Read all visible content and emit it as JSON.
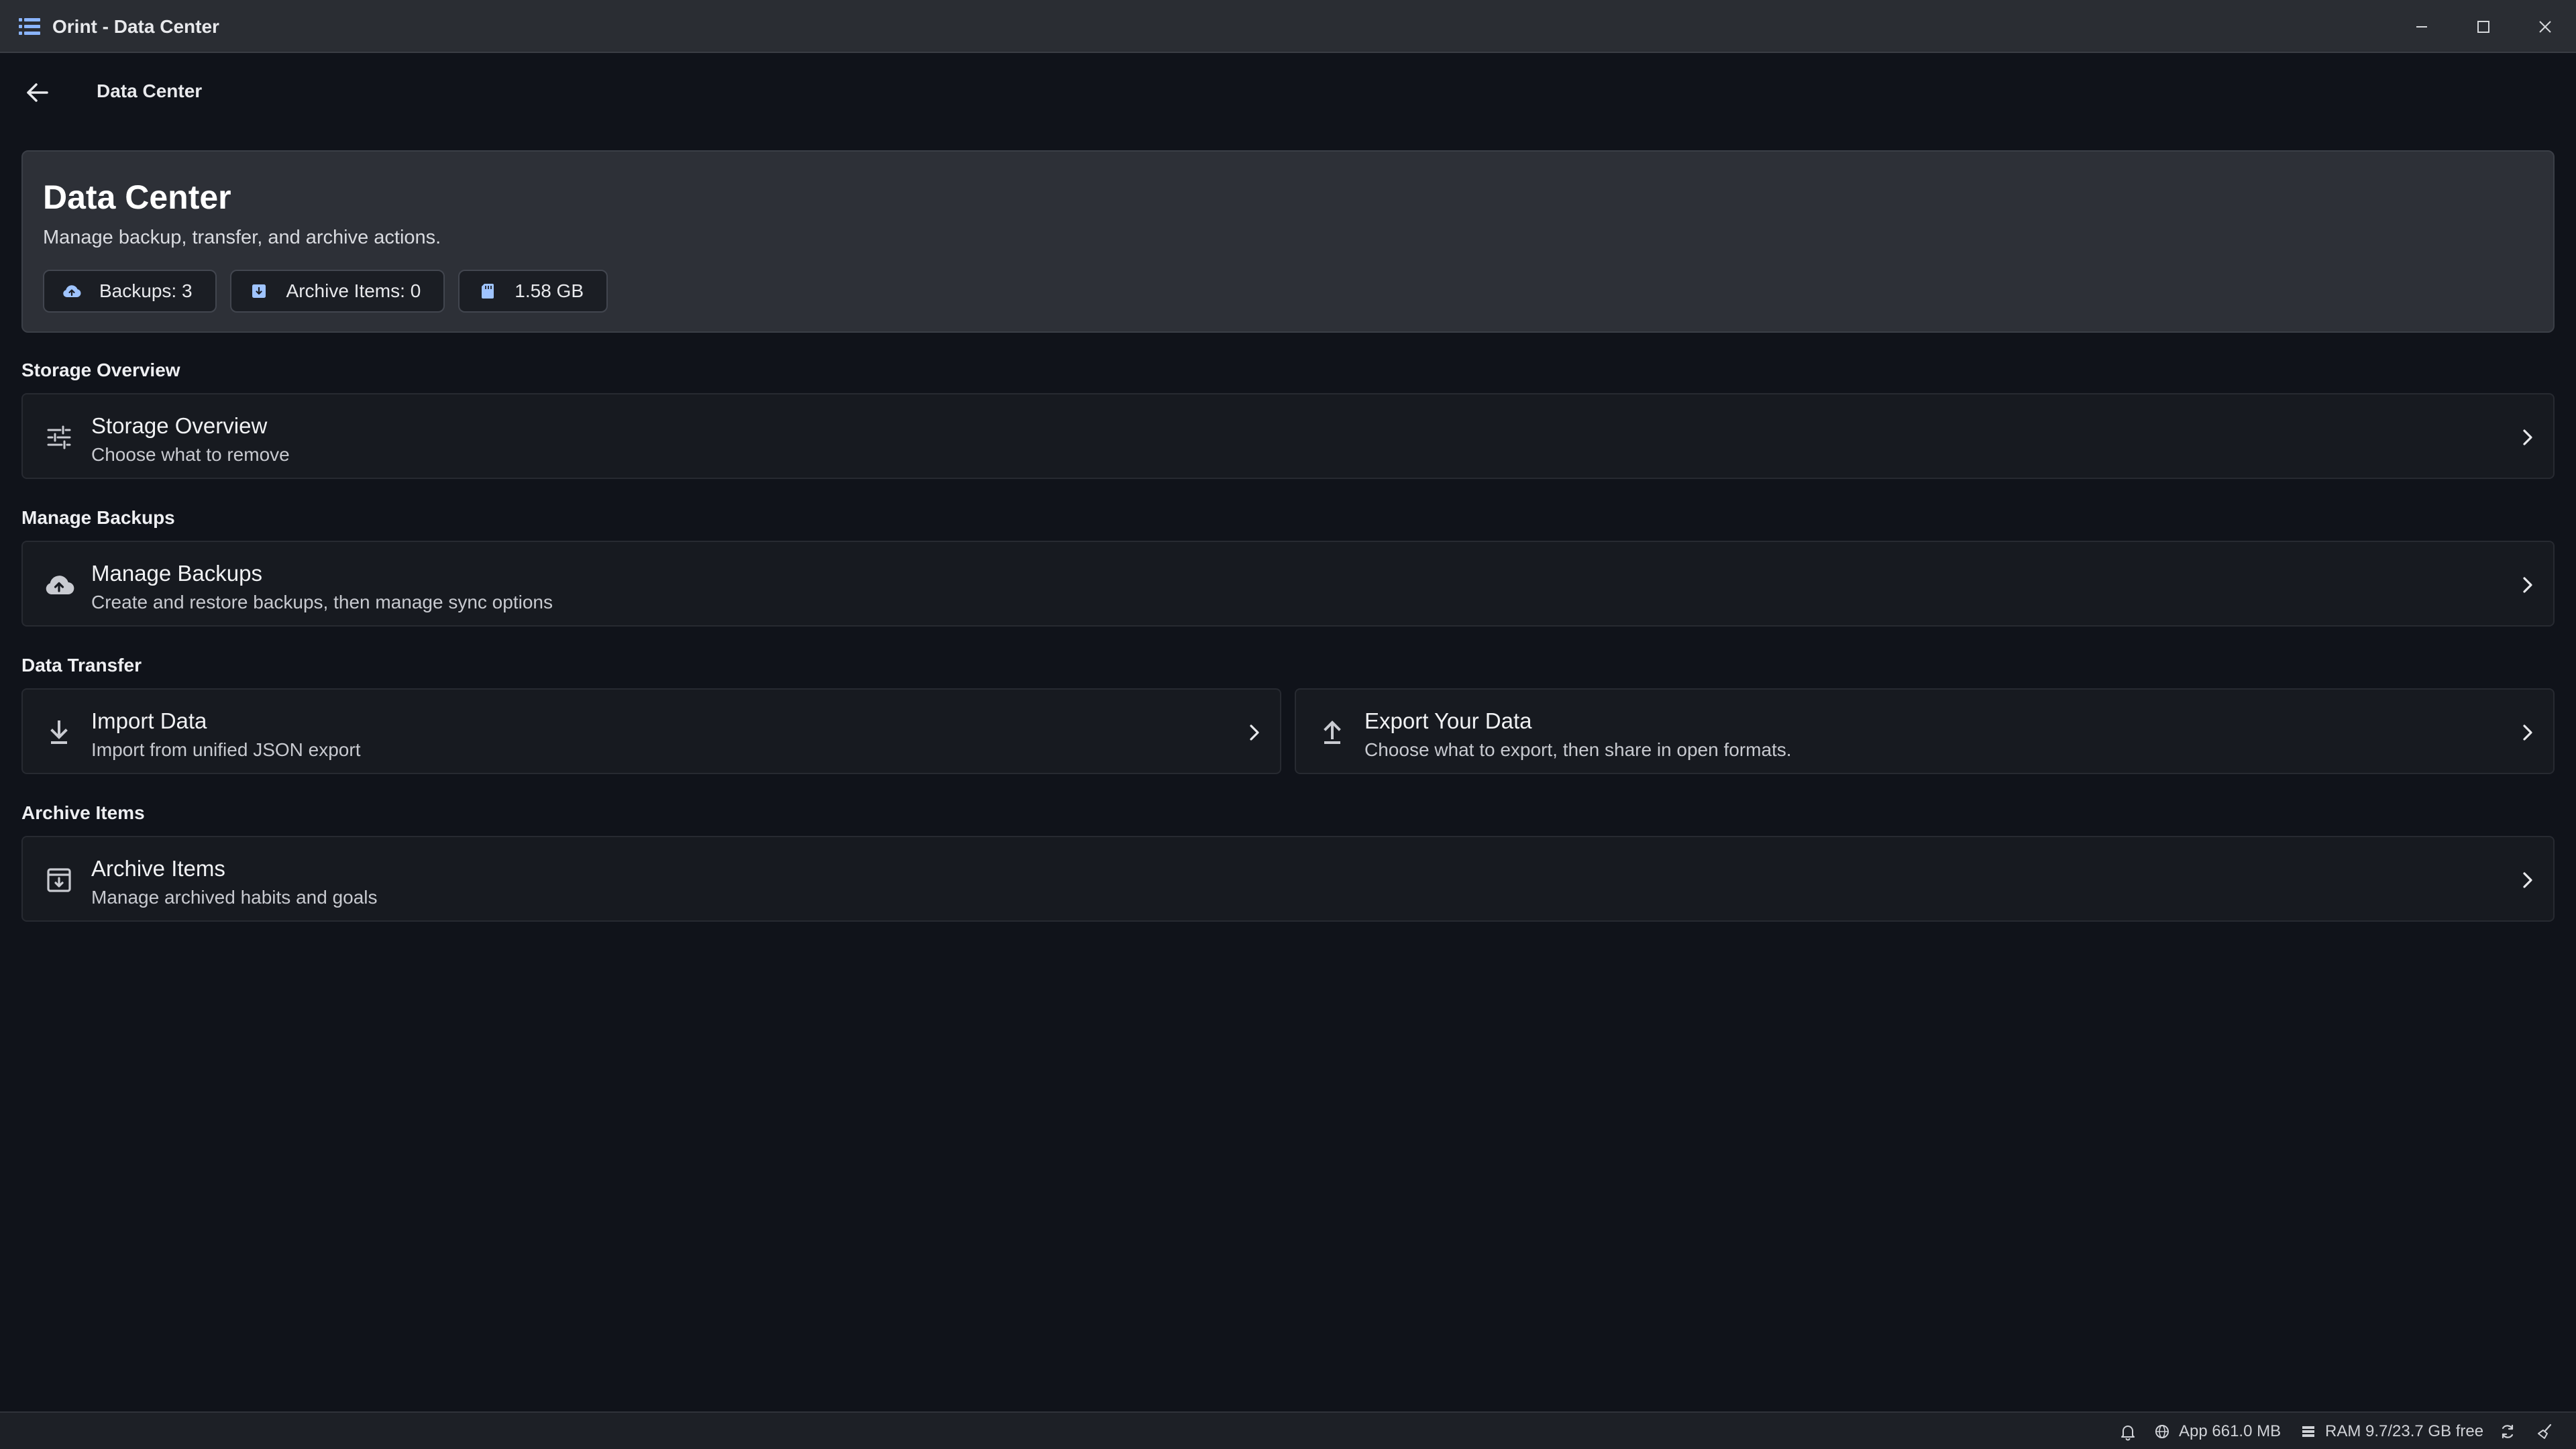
{
  "window": {
    "title": "Orint - Data Center",
    "controls": [
      "minimize",
      "maximize",
      "close"
    ]
  },
  "header": {
    "back_icon": "arrow-left-icon",
    "title": "Data Center"
  },
  "hero": {
    "title": "Data Center",
    "subtitle": "Manage backup, transfer, and archive actions.",
    "chips": [
      {
        "icon": "cloud-upload-icon",
        "label": "Backups: 3"
      },
      {
        "icon": "archive-icon",
        "label": "Archive Items: 0"
      },
      {
        "icon": "sd-card-icon",
        "label": "1.58 GB"
      }
    ]
  },
  "sections": {
    "storage": {
      "label": "Storage Overview",
      "card": {
        "icon": "tune-sliders-icon",
        "title": "Storage Overview",
        "subtitle": "Choose what to remove"
      }
    },
    "backups": {
      "label": "Manage Backups",
      "card": {
        "icon": "cloud-upload-icon",
        "title": "Manage Backups",
        "subtitle": "Create and restore backups, then manage sync options"
      }
    },
    "transfer": {
      "label": "Data Transfer",
      "import": {
        "icon": "download-icon",
        "title": "Import Data",
        "subtitle": "Import from unified JSON export"
      },
      "export": {
        "icon": "upload-icon",
        "title": "Export Your Data",
        "subtitle": "Choose what to export, then share in open formats."
      }
    },
    "archive": {
      "label": "Archive Items",
      "card": {
        "icon": "archive-box-icon",
        "title": "Archive Items",
        "subtitle": "Manage archived habits and goals"
      }
    }
  },
  "statusbar": {
    "app_memory": "App 661.0 MB",
    "ram": "RAM 9.7/23.7 GB free",
    "icons": [
      "bell-icon",
      "globe-icon",
      "server-icon",
      "sync-icon",
      "broom-icon"
    ]
  },
  "colors": {
    "background": "#10131a",
    "titlebar": "#2a2d33",
    "hero": "#2d3037",
    "card": "#171a20",
    "chip_icon": "#9fc4ff"
  }
}
